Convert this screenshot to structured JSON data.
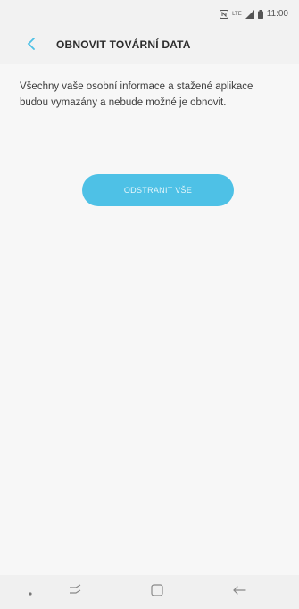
{
  "status_bar": {
    "time": "11:00",
    "lte_label": "LTE",
    "icons": [
      "nfc-icon",
      "lte-icon",
      "signal-icon",
      "battery-icon"
    ]
  },
  "header": {
    "back_icon": "chevron-left-icon",
    "title": "OBNOVIT TOVÁRNÍ DATA"
  },
  "main": {
    "description": "Všechny vaše osobní informace a stažené aplikace budou vymazány a nebude možné je obnovit.",
    "action_label": "ODSTRANIT VŠE"
  },
  "nav_bar": {
    "items": [
      "dot-icon",
      "recent-apps-icon",
      "home-icon",
      "back-arrow-icon"
    ]
  },
  "colors": {
    "accent": "#4ec1e6",
    "background": "#f7f7f7",
    "title_text": "#2c2c2c"
  }
}
